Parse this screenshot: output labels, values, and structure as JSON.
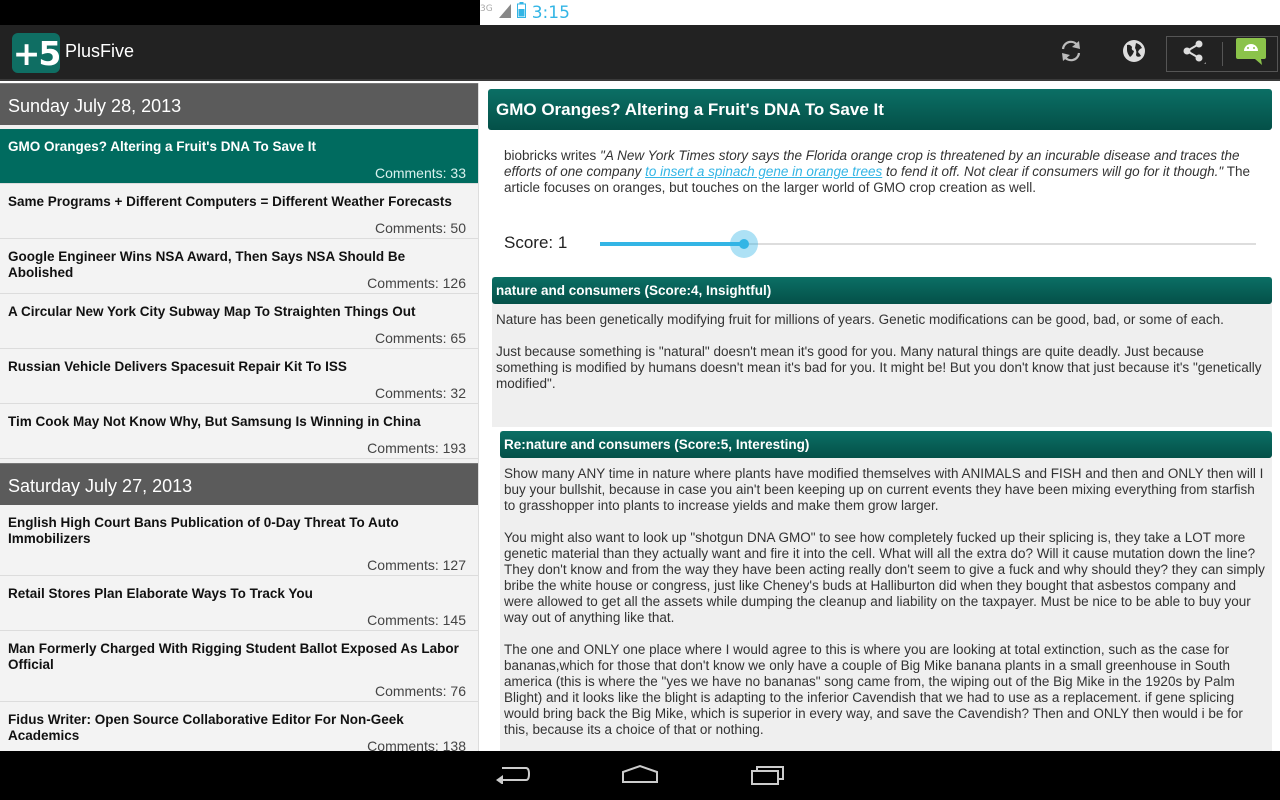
{
  "status_bar": {
    "network": "3G",
    "time": "3:15"
  },
  "action_bar": {
    "logo_text": "+5",
    "app_title": "PlusFive"
  },
  "story_list": {
    "days": [
      {
        "date": "Sunday July 28, 2013",
        "stories": [
          {
            "title": "GMO Oranges? Altering a Fruit's DNA To Save It",
            "comments": "Comments: 33",
            "selected": true
          },
          {
            "title": "Same Programs + Different Computers = Different Weather Forecasts",
            "comments": "Comments: 50"
          },
          {
            "title": "Google Engineer Wins NSA Award, Then Says NSA Should Be Abolished",
            "comments": "Comments: 126"
          },
          {
            "title": "A Circular New York City Subway Map To Straighten Things Out",
            "comments": "Comments: 65"
          },
          {
            "title": "Russian Vehicle Delivers Spacesuit Repair Kit To ISS",
            "comments": "Comments: 32"
          },
          {
            "title": "Tim Cook May Not Know Why, But Samsung Is Winning in China",
            "comments": "Comments: 193"
          }
        ]
      },
      {
        "date": "Saturday July 27, 2013",
        "stories": [
          {
            "title": "English High Court Bans Publication of 0-Day Threat To Auto Immobilizers",
            "comments": "Comments: 127"
          },
          {
            "title": "Retail Stores Plan Elaborate Ways To Track You",
            "comments": "Comments: 145"
          },
          {
            "title": "Man Formerly Charged With Rigging Student Ballot Exposed As Labor Official",
            "comments": "Comments: 76"
          },
          {
            "title": "Fidus Writer: Open Source Collaborative Editor For Non-Geek Academics",
            "comments": "Comments: 138"
          }
        ]
      }
    ]
  },
  "article": {
    "title": "GMO Oranges? Altering a Fruit's DNA To Save It",
    "summary_prefix": "biobricks writes ",
    "summary_quote_1": "\"A New York Times story says the Florida orange crop is threatened by an incurable disease and traces the efforts of one company ",
    "summary_link": "to insert a spinach gene in orange trees",
    "summary_quote_2": " to fend it off. Not clear if consumers will go for it though.\"",
    "summary_suffix": " The article focuses on oranges, but touches on the larger world of GMO crop creation as well.",
    "score_label": "Score: 1",
    "score_fraction": 0.22
  },
  "comments": [
    {
      "header": "nature and consumers (Score:4, Insightful)",
      "paragraphs": [
        "Nature has been genetically modifying fruit for millions of years. Genetic modifications can be good, bad, or some of each.",
        "Just because something is \"natural\" doesn't mean it's good for you. Many natural things are quite deadly. Just because something is modified by humans doesn't mean it's bad for you. It might be! But you don't know that just because it's \"genetically modified\"."
      ]
    },
    {
      "header": "Re:nature and consumers (Score:5, Interesting)",
      "paragraphs": [
        "Show many ANY time in nature where plants have modified themselves with ANIMALS and FISH and then and ONLY then will I buy your bullshit, because in case you ain't been keeping up on current events they have been mixing everything from starfish to grasshopper into plants to increase yields and make them grow larger.",
        "You might also want to look up \"shotgun DNA GMO\" to see how completely fucked up their splicing is, they take a LOT more genetic material than they actually want and fire it into the cell. What will all the extra do? Will it cause mutation down the line? They don't know and from the way they have been acting really don't seem to give a fuck and why should they? they can simply bribe the white house or congress, just like Cheney's buds at Halliburton did when they bought that asbestos company and were allowed to get all the assets while dumping the cleanup and liability on the taxpayer. Must be nice to be able to buy your way out of anything like that.",
        "The one and ONLY one place where I would agree to this is where you are looking at total extinction, such as the case for bananas,which for those that don't know we only have a couple of Big Mike banana plants in a small greenhouse in South america (this is where the \"yes we have no bananas\" song came from, the wiping out of the Big Mike in the 1920s by Palm Blight) and it looks like the blight is adapting to the inferior Cavendish that we had to use as a replacement. if gene splicing would bring back the Big Mike, which is superior in every way, and save the Cavendish? Then and ONLY then would i be for this, because its a choice of that or nothing."
      ]
    }
  ],
  "colors": {
    "accent": "#33b5e5",
    "teal": "#006b5f"
  }
}
